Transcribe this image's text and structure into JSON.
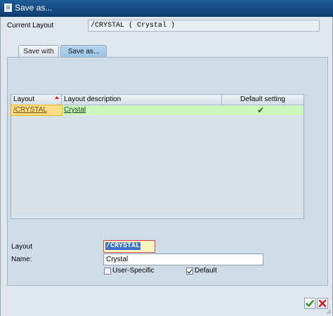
{
  "window": {
    "title": "Save as..."
  },
  "header": {
    "current_layout_label": "Current Layout",
    "current_layout_value": "/CRYSTAL ( Crystal )"
  },
  "tabs": [
    {
      "label": "Save with",
      "active": false
    },
    {
      "label": "Save as...",
      "active": true
    }
  ],
  "grid": {
    "columns": [
      "Layout",
      "Layout description",
      "Default setting"
    ],
    "rows": [
      {
        "layout": "/CRYSTAL",
        "description": "Crystal",
        "default_setting": true
      }
    ]
  },
  "form": {
    "layout_label": "Layout",
    "layout_value": "/CRYSTAL",
    "name_label": "Name:",
    "name_value": "Crystal",
    "user_specific_label": "User-Specific",
    "user_specific_checked": false,
    "default_label": "Default",
    "default_checked": true
  },
  "colors": {
    "title_bar": "#1e5e99",
    "row_highlight": "#cdf7bd",
    "selected_cell": "#f8dd8a",
    "ok_green": "#2e8b1e",
    "cancel_red": "#cc1a1a"
  },
  "icons": {
    "window": "window-icon",
    "sort": "sort-ascending-icon",
    "default_check": "checkmark-icon",
    "ok": "ok-check-icon",
    "cancel": "cancel-x-icon"
  }
}
